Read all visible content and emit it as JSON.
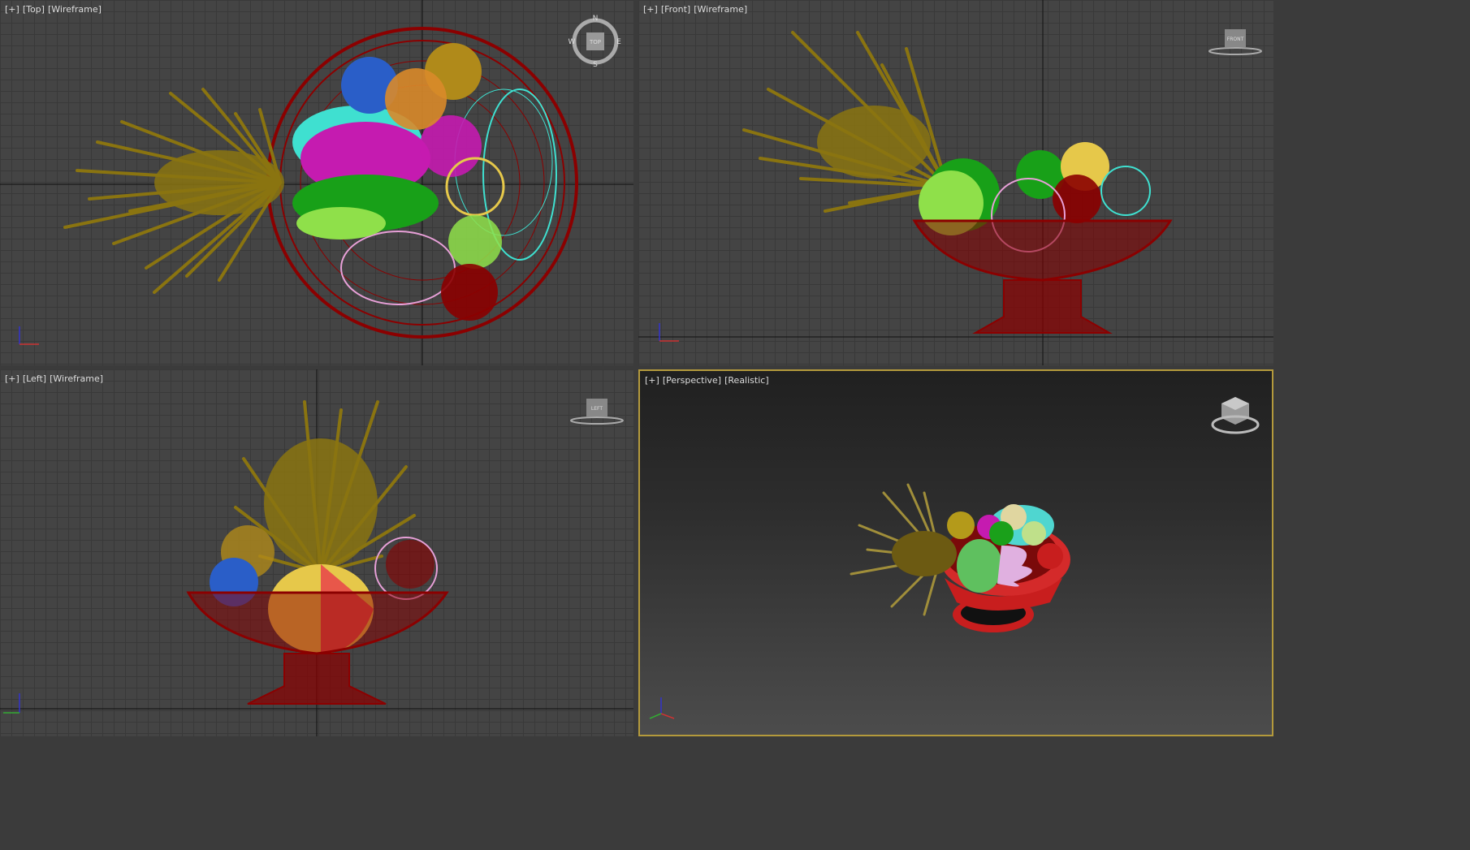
{
  "viewports": {
    "top": {
      "labels": [
        "[+]",
        "[Top]",
        "[Wireframe]"
      ],
      "cube_label": "TOP",
      "compass": {
        "n": "N",
        "s": "S",
        "e": "E",
        "w": "W"
      }
    },
    "front": {
      "labels": [
        "[+]",
        "[Front]",
        "[Wireframe]"
      ],
      "cube_label": "FRONT"
    },
    "left": {
      "labels": [
        "[+]",
        "[Left]",
        "[Wireframe]"
      ],
      "cube_label": "LEFT"
    },
    "perspective": {
      "labels": [
        "[+]",
        "[Perspective]",
        "[Realistic]"
      ]
    }
  },
  "colors": {
    "viewport_bg": "#444444",
    "grid": "#393939",
    "active_border": "#b49a3c",
    "pineapple": "#8a7410",
    "bowl": "#8b0000",
    "aqua": "#3fe0d0",
    "magenta": "#c51bb0",
    "green": "#18a018",
    "lightgreen": "#8fe04a",
    "blue": "#2a5ec8",
    "orange": "#d98a2a",
    "yellow": "#e6c84a",
    "pink": "#e8a0d8",
    "red": "#c81e1e"
  },
  "icons": [
    "viewcube-icon",
    "compass-icon",
    "axis-tripod-icon"
  ]
}
